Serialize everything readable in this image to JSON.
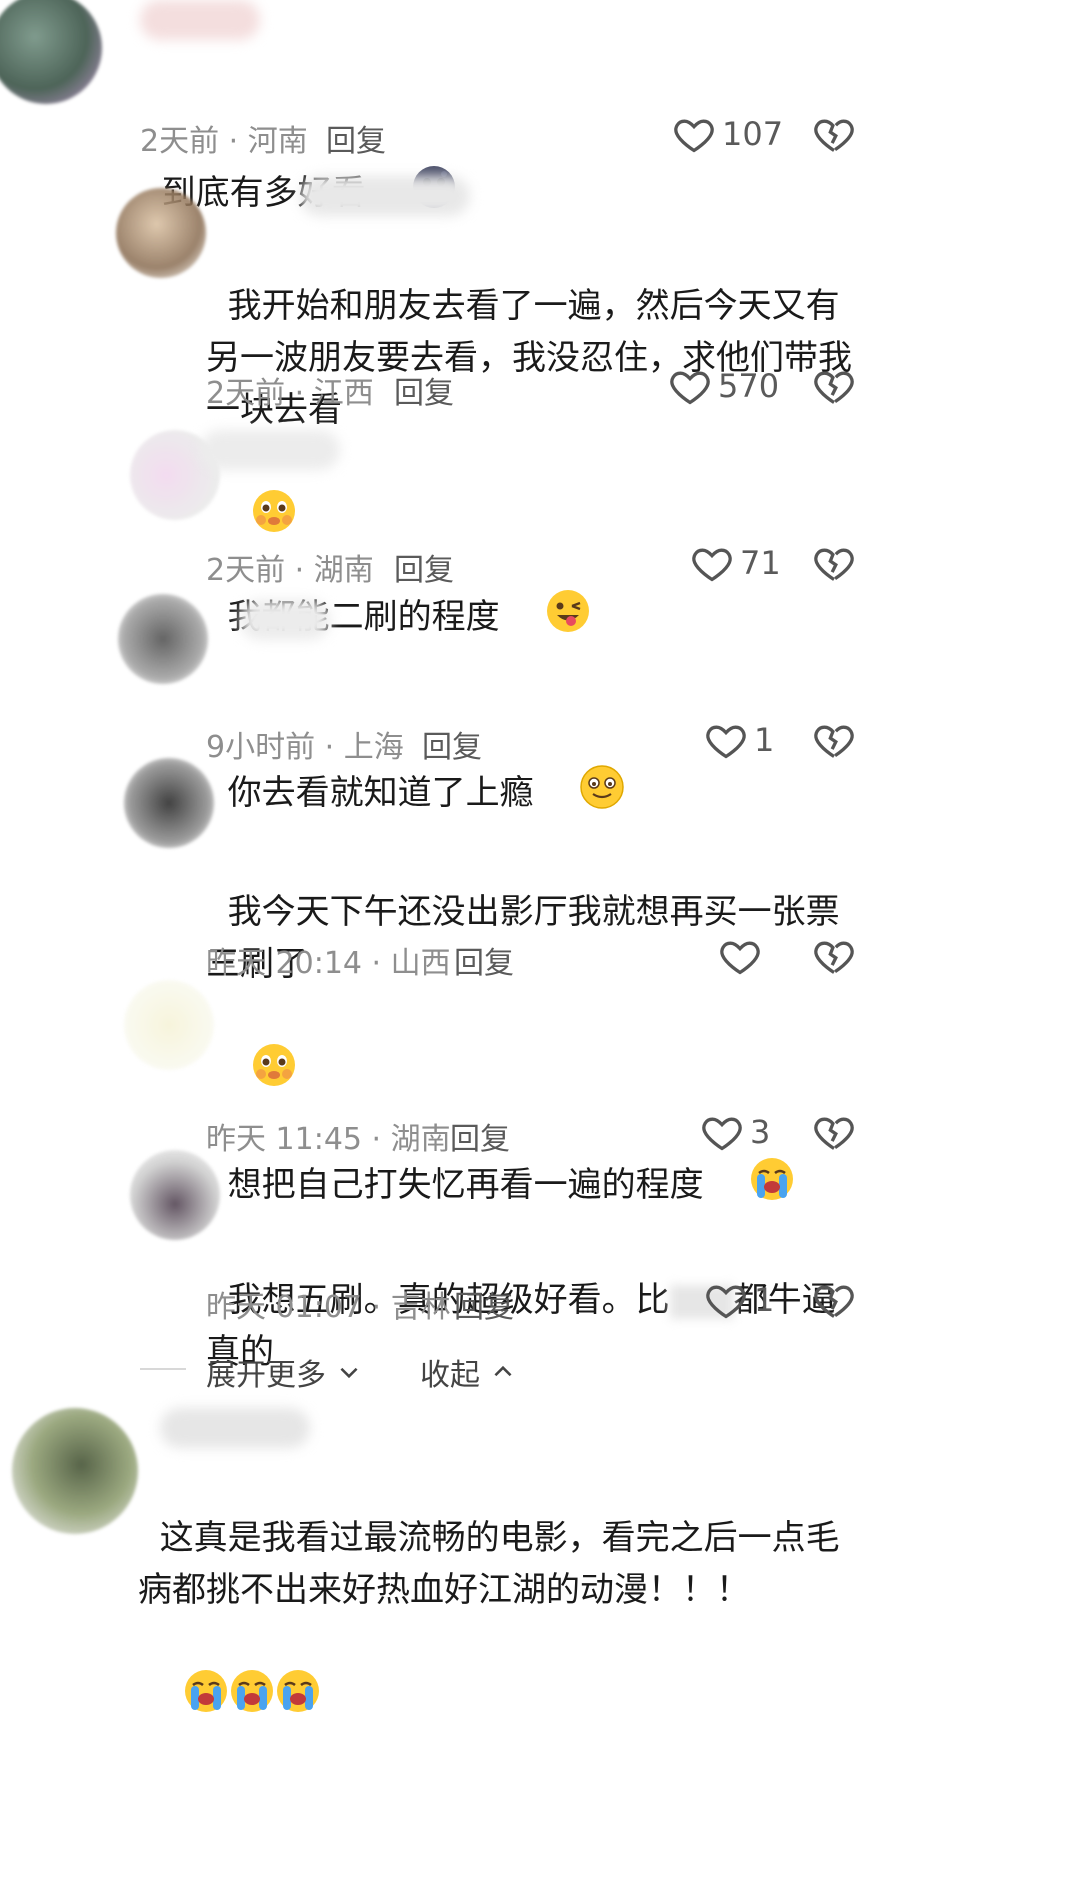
{
  "comments": [
    {
      "text": "到底有多好看",
      "time": "2天前 · 河南",
      "reply": "回复",
      "likes": "107",
      "emoji": "new-moon-face"
    },
    {
      "text": "我开始和朋友去看了一遍，然后今天又有另一波朋友要去看，我没忍住，求他们带我一块去看",
      "time": "2天前 · 江西",
      "reply": "回复",
      "likes": "570",
      "emoji": "pleading-face"
    },
    {
      "text": "我都能二刷的程度",
      "time": "2天前 · 湖南",
      "reply": "回复",
      "likes": "71",
      "emoji": "winking-tongue-face"
    },
    {
      "text": "你去看就知道了上瘾",
      "time": "9小时前 · 上海",
      "reply": "回复",
      "likes": "1",
      "emoji": "smiling-face"
    },
    {
      "text": "我今天下午还没出影厅我就想再买一张票三刷了",
      "time": "昨天 20:14 · 山西",
      "reply": "回复",
      "likes": "",
      "emoji": "pleading-face"
    },
    {
      "text": "想把自己打失忆再看一遍的程度",
      "time": "昨天 11:45 · 湖南",
      "reply": "回复",
      "likes": "3",
      "emoji": "loudly-crying-face"
    },
    {
      "text": "我想五刷。真的超级好看。比",
      "text_after": "都牛逼真的",
      "time": "昨天 01:07 · 吉林",
      "reply": "回复",
      "likes": "1"
    }
  ],
  "expand": {
    "more": "展开更多",
    "collapse": "收起"
  },
  "last_comment": {
    "text": "这真是我看过最流畅的电影，看完之后一点毛病都挑不出来好热血好江湖的动漫！！！",
    "emoji": "loudly-crying-face"
  },
  "colors": {
    "meta": "#8e8e8e",
    "text": "#1a1a1a",
    "divider": "#d8d8d8"
  }
}
